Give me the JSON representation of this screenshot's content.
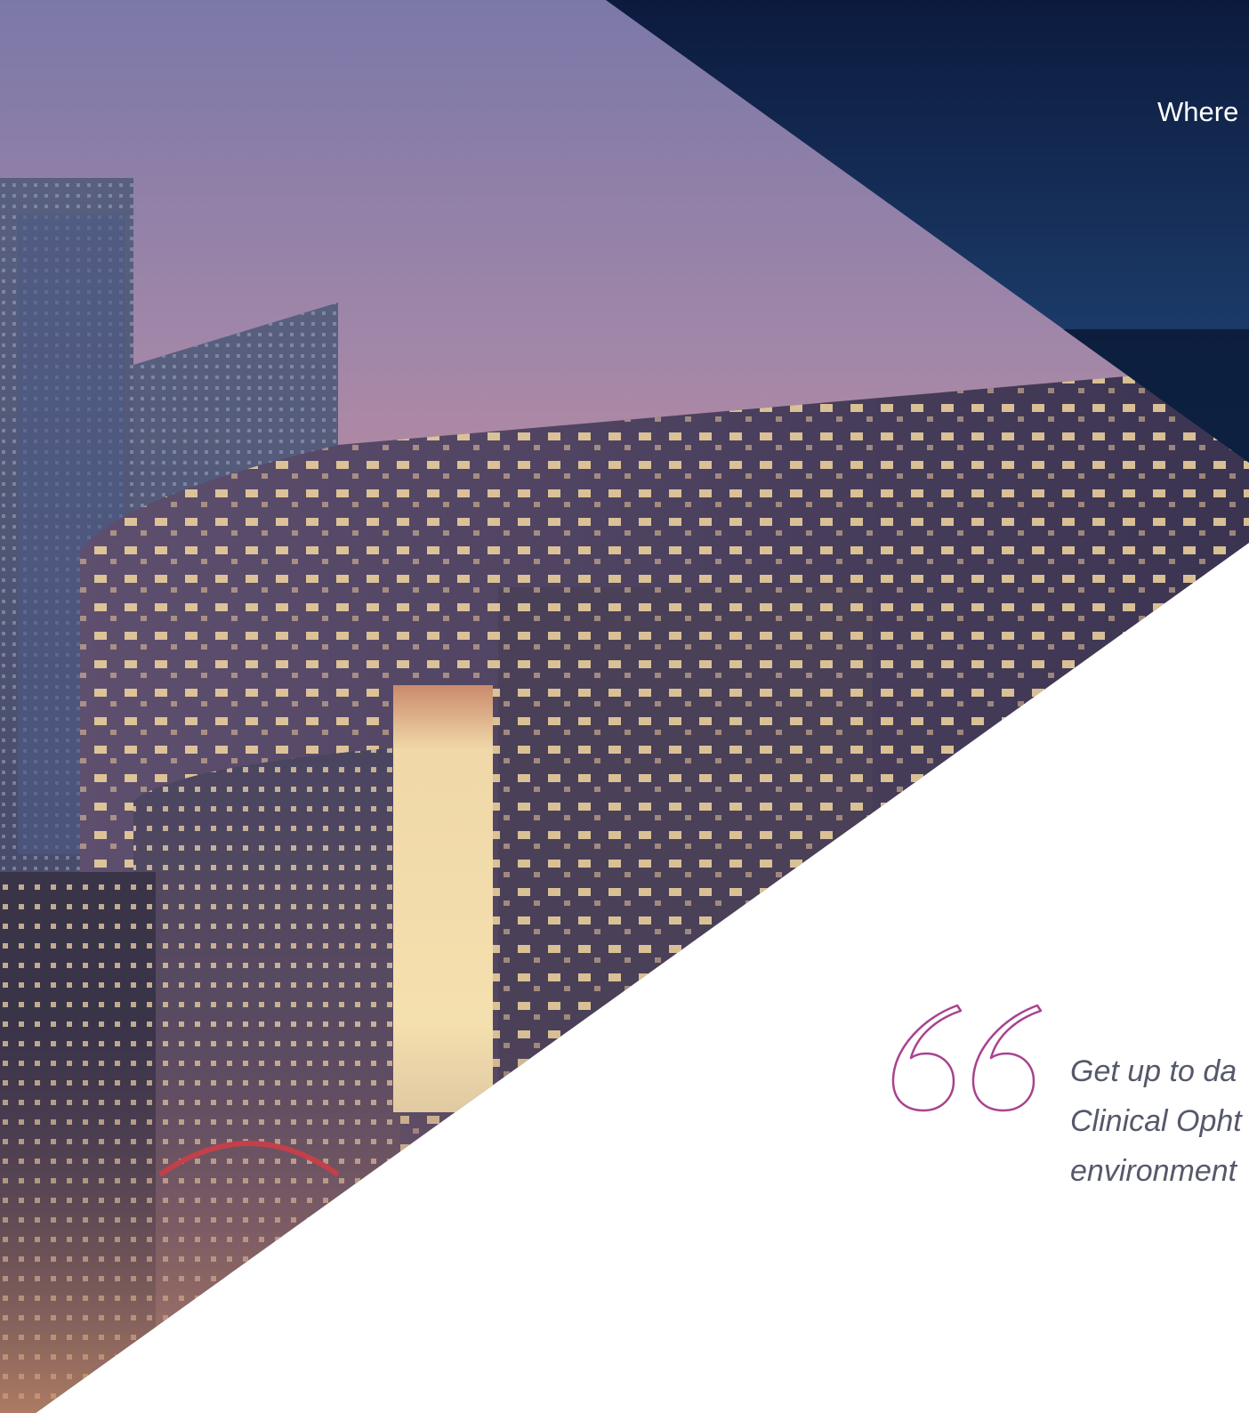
{
  "banner": {
    "text": "Where"
  },
  "quote": {
    "lines": [
      "Get up to da",
      "Clinical Opht",
      "environment"
    ]
  },
  "colors": {
    "navy_dark": "#0b1b3f",
    "navy_light": "#1c3f6e",
    "quote_mark": "#a8438e",
    "quote_text": "#55596a",
    "sky_top": "#7d7aa8",
    "sky_bottom": "#c88a9c"
  },
  "icons": {
    "quote_mark": "open-quote-icon",
    "photo": "city-skyline-photo"
  }
}
